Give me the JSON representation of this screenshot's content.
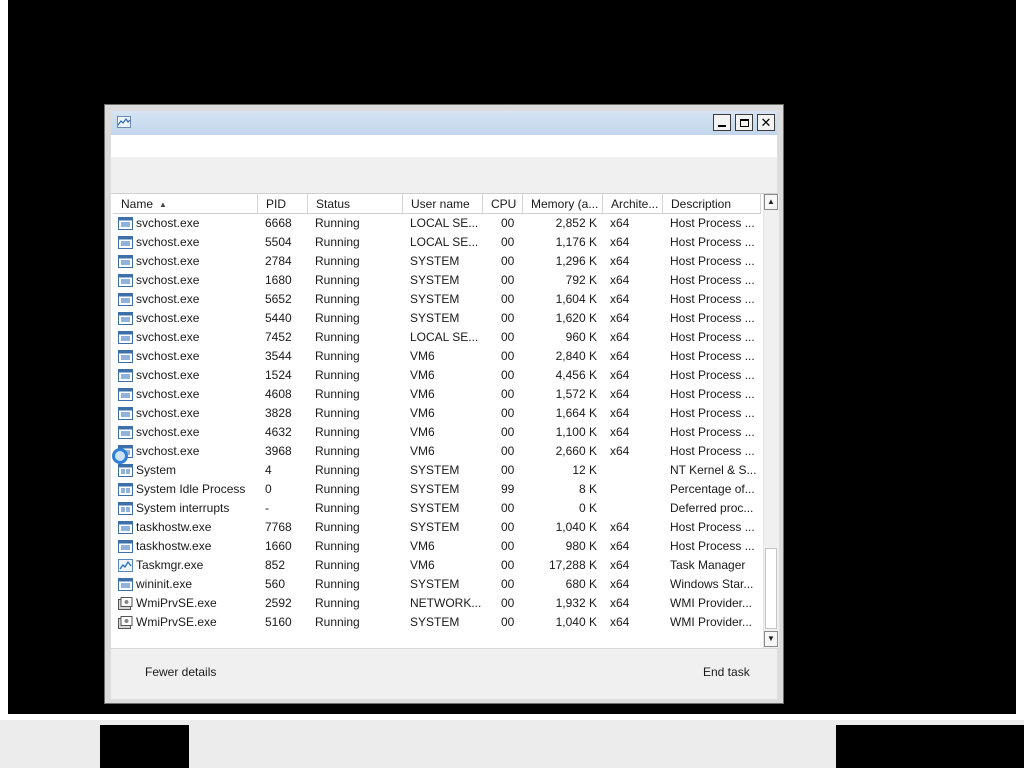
{
  "columns": [
    {
      "key": "name",
      "label": "Name",
      "sort": "ascending"
    },
    {
      "key": "pid",
      "label": "PID"
    },
    {
      "key": "status",
      "label": "Status"
    },
    {
      "key": "user",
      "label": "User name"
    },
    {
      "key": "cpu",
      "label": "CPU"
    },
    {
      "key": "mem",
      "label": "Memory (a..."
    },
    {
      "key": "arch",
      "label": "Archite..."
    },
    {
      "key": "desc",
      "label": "Description"
    }
  ],
  "rows": [
    {
      "icon": "service-host-icon",
      "name": "svchost.exe",
      "pid": "6668",
      "status": "Running",
      "user": "LOCAL SE...",
      "cpu": "00",
      "mem": "2,852 K",
      "arch": "x64",
      "desc": "Host Process ..."
    },
    {
      "icon": "service-host-icon",
      "name": "svchost.exe",
      "pid": "5504",
      "status": "Running",
      "user": "LOCAL SE...",
      "cpu": "00",
      "mem": "1,176 K",
      "arch": "x64",
      "desc": "Host Process ..."
    },
    {
      "icon": "service-host-icon",
      "name": "svchost.exe",
      "pid": "2784",
      "status": "Running",
      "user": "SYSTEM",
      "cpu": "00",
      "mem": "1,296 K",
      "arch": "x64",
      "desc": "Host Process ..."
    },
    {
      "icon": "service-host-icon",
      "name": "svchost.exe",
      "pid": "1680",
      "status": "Running",
      "user": "SYSTEM",
      "cpu": "00",
      "mem": "792 K",
      "arch": "x64",
      "desc": "Host Process ..."
    },
    {
      "icon": "service-host-icon",
      "name": "svchost.exe",
      "pid": "5652",
      "status": "Running",
      "user": "SYSTEM",
      "cpu": "00",
      "mem": "1,604 K",
      "arch": "x64",
      "desc": "Host Process ..."
    },
    {
      "icon": "service-host-icon",
      "name": "svchost.exe",
      "pid": "5440",
      "status": "Running",
      "user": "SYSTEM",
      "cpu": "00",
      "mem": "1,620 K",
      "arch": "x64",
      "desc": "Host Process ..."
    },
    {
      "icon": "service-host-icon",
      "name": "svchost.exe",
      "pid": "7452",
      "status": "Running",
      "user": "LOCAL SE...",
      "cpu": "00",
      "mem": "960 K",
      "arch": "x64",
      "desc": "Host Process ..."
    },
    {
      "icon": "service-host-icon",
      "name": "svchost.exe",
      "pid": "3544",
      "status": "Running",
      "user": "VM6",
      "cpu": "00",
      "mem": "2,840 K",
      "arch": "x64",
      "desc": "Host Process ..."
    },
    {
      "icon": "service-host-icon",
      "name": "svchost.exe",
      "pid": "1524",
      "status": "Running",
      "user": "VM6",
      "cpu": "00",
      "mem": "4,456 K",
      "arch": "x64",
      "desc": "Host Process ..."
    },
    {
      "icon": "service-host-icon",
      "name": "svchost.exe",
      "pid": "4608",
      "status": "Running",
      "user": "VM6",
      "cpu": "00",
      "mem": "1,572 K",
      "arch": "x64",
      "desc": "Host Process ..."
    },
    {
      "icon": "service-host-icon",
      "name": "svchost.exe",
      "pid": "3828",
      "status": "Running",
      "user": "VM6",
      "cpu": "00",
      "mem": "1,664 K",
      "arch": "x64",
      "desc": "Host Process ..."
    },
    {
      "icon": "service-host-icon",
      "name": "svchost.exe",
      "pid": "4632",
      "status": "Running",
      "user": "VM6",
      "cpu": "00",
      "mem": "1,100 K",
      "arch": "x64",
      "desc": "Host Process ..."
    },
    {
      "icon": "service-host-icon",
      "name": "svchost.exe",
      "pid": "3968",
      "status": "Running",
      "user": "VM6",
      "cpu": "00",
      "mem": "2,660 K",
      "arch": "x64",
      "desc": "Host Process ..."
    },
    {
      "icon": "system-process-icon",
      "name": "System",
      "pid": "4",
      "status": "Running",
      "user": "SYSTEM",
      "cpu": "00",
      "mem": "12 K",
      "arch": "",
      "desc": "NT Kernel & S..."
    },
    {
      "icon": "system-process-icon",
      "name": "System Idle Process",
      "pid": "0",
      "status": "Running",
      "user": "SYSTEM",
      "cpu": "99",
      "mem": "8 K",
      "arch": "",
      "desc": "Percentage of..."
    },
    {
      "icon": "system-process-icon",
      "name": "System interrupts",
      "pid": "-",
      "status": "Running",
      "user": "SYSTEM",
      "cpu": "00",
      "mem": "0 K",
      "arch": "",
      "desc": "Deferred proc..."
    },
    {
      "icon": "service-host-icon",
      "name": "taskhostw.exe",
      "pid": "7768",
      "status": "Running",
      "user": "SYSTEM",
      "cpu": "00",
      "mem": "1,040 K",
      "arch": "x64",
      "desc": "Host Process ..."
    },
    {
      "icon": "service-host-icon",
      "name": "taskhostw.exe",
      "pid": "1660",
      "status": "Running",
      "user": "VM6",
      "cpu": "00",
      "mem": "980 K",
      "arch": "x64",
      "desc": "Host Process ..."
    },
    {
      "icon": "task-manager-icon",
      "name": "Taskmgr.exe",
      "pid": "852",
      "status": "Running",
      "user": "VM6",
      "cpu": "00",
      "mem": "17,288 K",
      "arch": "x64",
      "desc": "Task Manager"
    },
    {
      "icon": "service-host-icon",
      "name": "wininit.exe",
      "pid": "560",
      "status": "Running",
      "user": "SYSTEM",
      "cpu": "00",
      "mem": "680 K",
      "arch": "x64",
      "desc": "Windows Star..."
    },
    {
      "icon": "wmi-provider-icon",
      "name": "WmiPrvSE.exe",
      "pid": "2592",
      "status": "Running",
      "user": "NETWORK...",
      "cpu": "00",
      "mem": "1,932 K",
      "arch": "x64",
      "desc": "WMI Provider..."
    },
    {
      "icon": "wmi-provider-icon",
      "name": "WmiPrvSE.exe",
      "pid": "5160",
      "status": "Running",
      "user": "SYSTEM",
      "cpu": "00",
      "mem": "1,040 K",
      "arch": "x64",
      "desc": "WMI Provider..."
    }
  ],
  "footer": {
    "fewer_details_label": "Fewer details",
    "end_task_label": "End task"
  },
  "title_bar": {
    "minimize_glyph": "",
    "close_glyph": "✕"
  },
  "scrollbar": {
    "up_glyph": "▲",
    "down_glyph": "▼"
  }
}
